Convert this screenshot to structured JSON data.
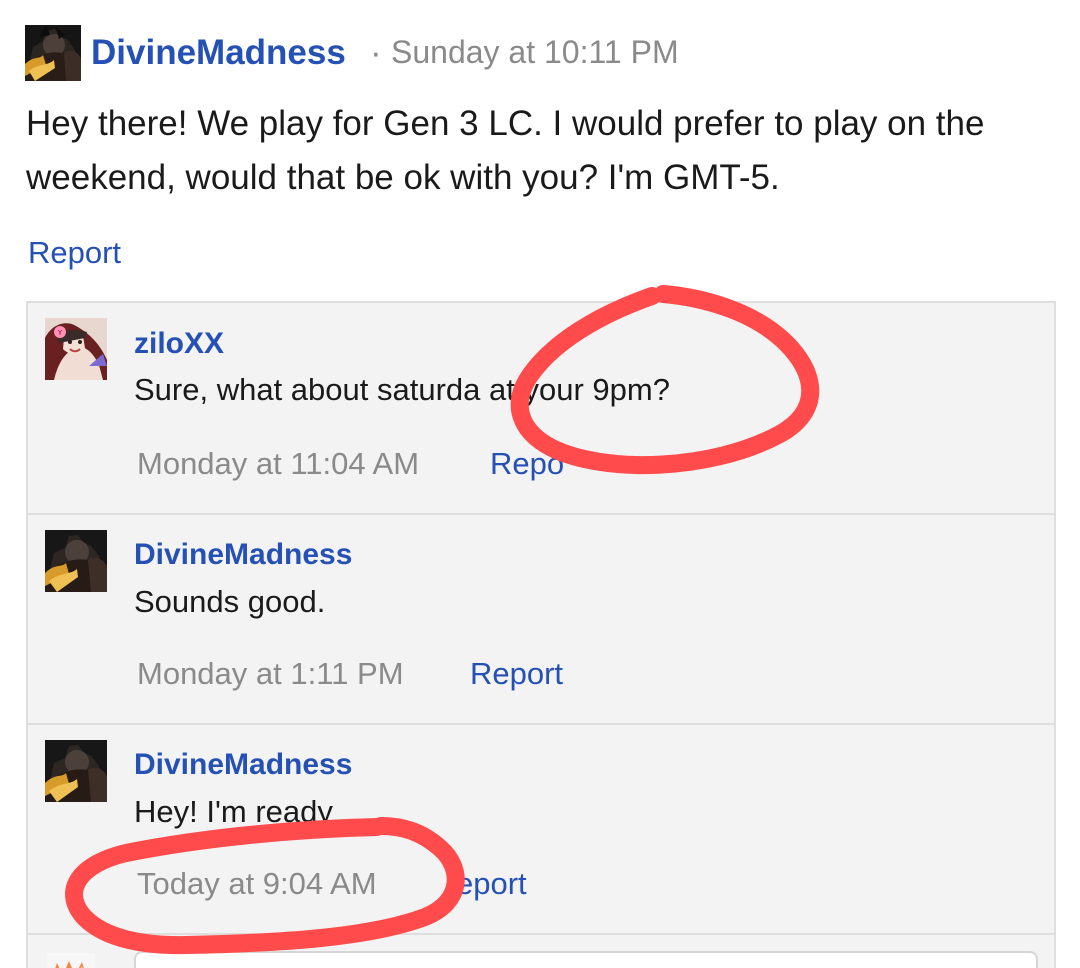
{
  "post": {
    "author": "DivineMadness",
    "separator": "·",
    "timestamp": "Sunday at 10:11 PM",
    "body": "Hey there! We play for Gen 3 LC. I would prefer to play on the weekend, would that be ok with you? I'm GMT-5.",
    "report_label": "Report"
  },
  "replies": [
    {
      "author": "ziloXX",
      "body": "Sure, what about saturda  at your 9pm?",
      "timestamp": "Monday at 11:04 AM",
      "report_label": "Repo"
    },
    {
      "author": "DivineMadness",
      "body": "Sounds good.",
      "timestamp": "Monday at 1:11 PM",
      "report_label": "Report"
    },
    {
      "author": "DivineMadness",
      "body": "Hey! I'm ready",
      "timestamp": "Today at 9:04 AM",
      "report_label": "eport"
    }
  ],
  "colors": {
    "link": "#2550b4",
    "annotation": "#ff4b4b",
    "muted": "#8a8a8a",
    "reply_bg": "#f3f3f3"
  },
  "icons": {
    "avatar_divine": "avatar-divinemadness-icon",
    "avatar_zilo": "avatar-ziloxx-icon",
    "current_user_avatar": "current-user-avatar-icon"
  }
}
